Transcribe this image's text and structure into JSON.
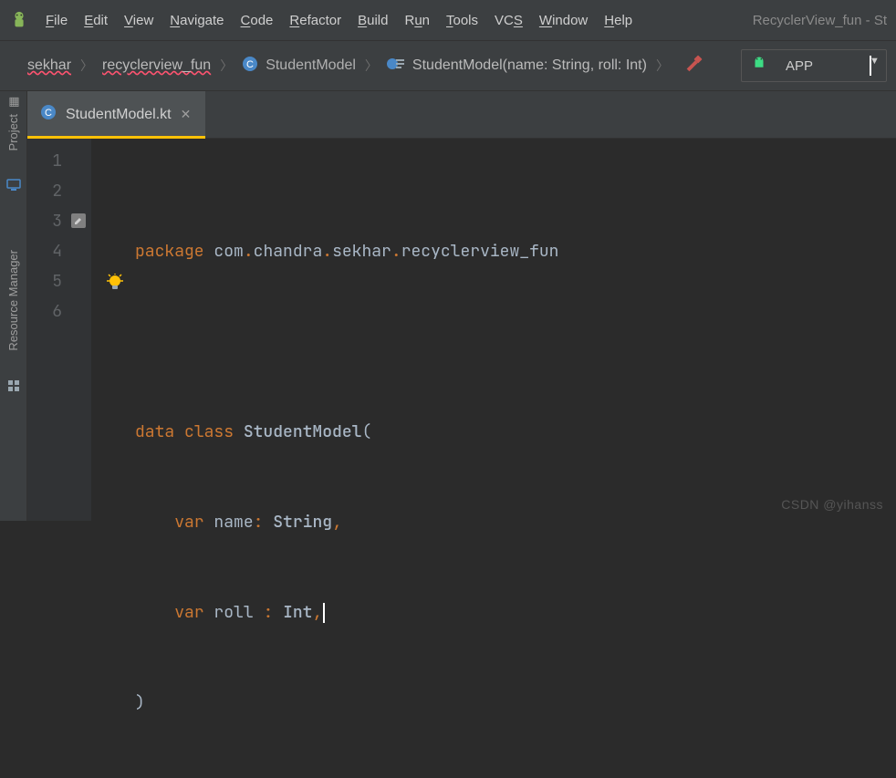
{
  "window_title": "RecyclerView_fun - St",
  "menu": {
    "items": [
      {
        "label": "File",
        "accel": "F"
      },
      {
        "label": "Edit",
        "accel": "E"
      },
      {
        "label": "View",
        "accel": "V"
      },
      {
        "label": "Navigate",
        "accel": "N"
      },
      {
        "label": "Code",
        "accel": "C"
      },
      {
        "label": "Refactor",
        "accel": "R"
      },
      {
        "label": "Build",
        "accel": "B"
      },
      {
        "label": "Run",
        "accel": "u"
      },
      {
        "label": "Tools",
        "accel": "T"
      },
      {
        "label": "VCS",
        "accel": "S"
      },
      {
        "label": "Window",
        "accel": "W"
      },
      {
        "label": "Help",
        "accel": "H"
      }
    ]
  },
  "breadcrumbs": {
    "path_sekhar": "sekhar",
    "path_pkg": "recyclerview_fun",
    "class_name": "StudentModel",
    "ctor_sig": "StudentModel(name: String, roll: Int)"
  },
  "run_config": {
    "label": "APP"
  },
  "left_tools": {
    "project": "Project",
    "resource_mgr": "Resource Manager"
  },
  "tab": {
    "filename": "StudentModel.kt"
  },
  "editor": {
    "lines": [
      "1",
      "2",
      "3",
      "4",
      "5",
      "6"
    ],
    "pkg_kw": "package",
    "pkg_parts": [
      "com",
      "chandra",
      "sekhar",
      "recyclerview_fun"
    ],
    "data_kw": "data",
    "class_kw": "class",
    "class_name": "StudentModel",
    "var_kw": "var",
    "field1": "name",
    "type1": "String",
    "field2": "roll",
    "type2": "Int"
  },
  "watermark": "CSDN @yihanss"
}
